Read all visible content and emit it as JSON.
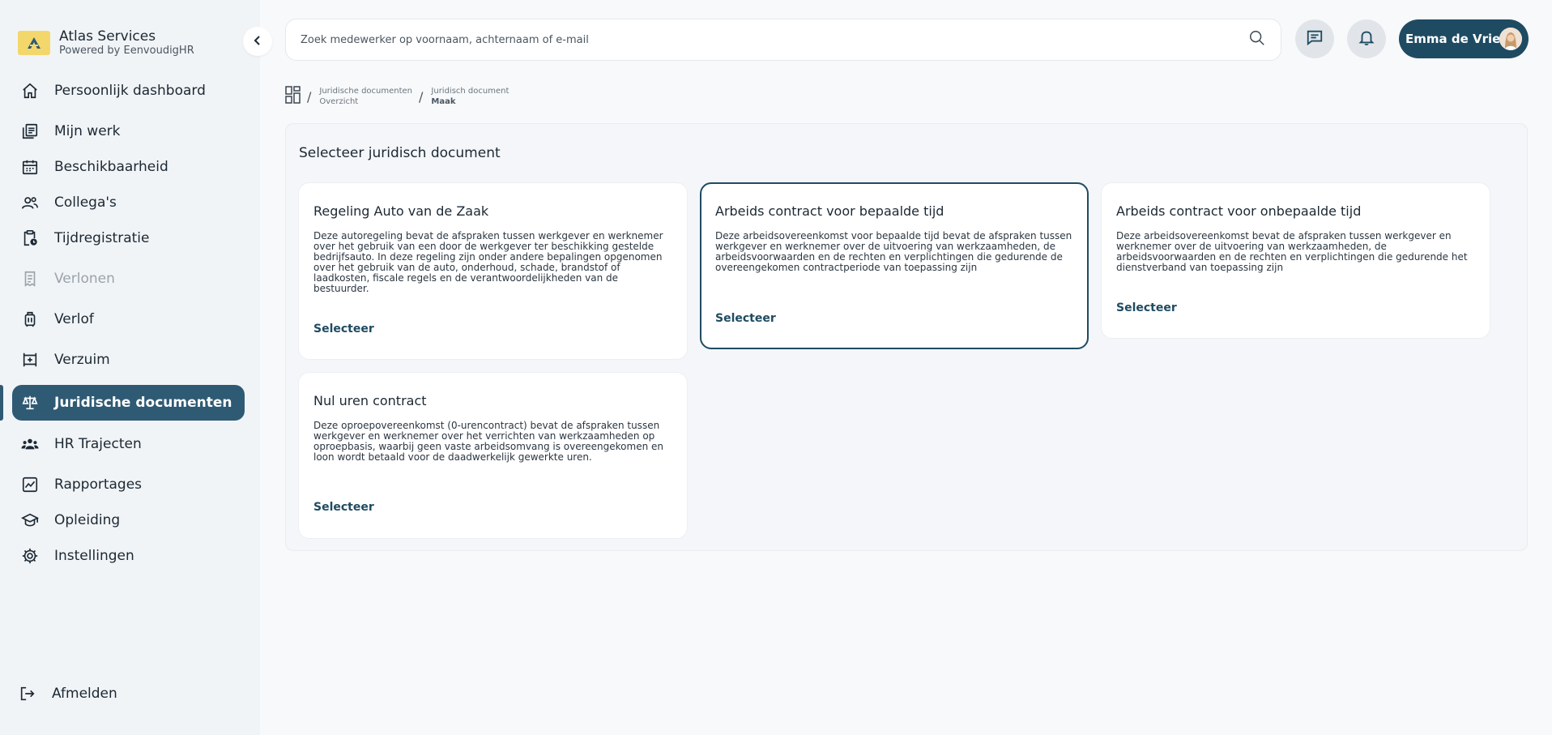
{
  "brand": {
    "name": "Atlas Services",
    "subtitle": "Powered by EenvoudigHR"
  },
  "sidebar": {
    "items": [
      {
        "label": "Persoonlijk dashboard"
      },
      {
        "label": "Mijn werk"
      },
      {
        "label": "Beschikbaarheid"
      },
      {
        "label": "Collega's"
      },
      {
        "label": "Tijdregistratie"
      },
      {
        "label": "Verlonen"
      },
      {
        "label": "Verlof"
      },
      {
        "label": "Verzuim"
      },
      {
        "label": "Juridische documenten"
      },
      {
        "label": "HR Trajecten"
      },
      {
        "label": "Rapportages"
      },
      {
        "label": "Opleiding"
      },
      {
        "label": "Instellingen"
      }
    ],
    "logout": "Afmelden"
  },
  "search": {
    "placeholder": "Zoek medewerker op voornaam, achternaam of e-mail"
  },
  "user": {
    "name": "Emma de Vries"
  },
  "breadcrumb": {
    "first": {
      "line1": "Juridische documenten",
      "line2": "Overzicht"
    },
    "second": {
      "line1": "Juridisch document",
      "line2": "Maak"
    }
  },
  "main": {
    "title": "Selecteer juridisch document",
    "cards": [
      {
        "title": "Regeling Auto van de Zaak",
        "description": "Deze autoregeling bevat de afspraken tussen werkgever en werknemer over het gebruik van een door de werkgever ter beschikking gestelde bedrijfsauto. In deze regeling zijn onder andere bepalingen opgenomen over het gebruik van de auto, onderhoud, schade, brandstof of laadkosten, fiscale regels en de verantwoordelijkheden van de bestuurder.",
        "action": "Selecteer"
      },
      {
        "title": "Arbeids contract voor bepaalde tijd",
        "description": "Deze arbeidsovereenkomst voor bepaalde tijd bevat de afspraken tussen werkgever en werknemer over de uitvoering van werkzaamheden, de arbeidsvoorwaarden en de rechten en verplichtingen die gedurende de overeengekomen contractperiode van toepassing zijn",
        "action": "Selecteer"
      },
      {
        "title": "Arbeids contract voor onbepaalde tijd",
        "description": "Deze arbeidsovereenkomst bevat de afspraken tussen werkgever en werknemer over de uitvoering van werkzaamheden, de arbeidsvoorwaarden en de rechten en verplichtingen die gedurende het dienstverband van toepassing zijn",
        "action": "Selecteer"
      },
      {
        "title": "Nul uren contract",
        "description": "Deze oproepovereenkomst (0-urencontract) bevat de afspraken tussen werkgever en werknemer over het verrichten van werkzaamheden op oproepbasis, waarbij geen vaste arbeidsomvang is overeengekomen en loon wordt betaald voor de daadwerkelijk gewerkte uren.",
        "action": "Selecteer"
      }
    ]
  },
  "colors": {
    "primary": "#1f4b62",
    "active_nav": "#2f5a74",
    "logo_bg": "#f3d76a"
  }
}
